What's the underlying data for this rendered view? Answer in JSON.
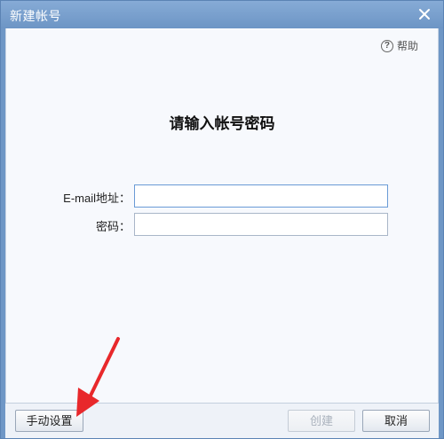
{
  "window": {
    "title": "新建帐号"
  },
  "help": {
    "label": "帮助",
    "icon": "?"
  },
  "main": {
    "heading": "请输入帐号密码"
  },
  "form": {
    "email_label": "E-mail地址：",
    "email_value": "",
    "password_label": "密码：",
    "password_value": ""
  },
  "buttons": {
    "manual_label": "手动设置",
    "create_label": "创建",
    "cancel_label": "取消"
  },
  "colors": {
    "titlebar": "#7aa0cd",
    "arrow": "#e8282b"
  }
}
